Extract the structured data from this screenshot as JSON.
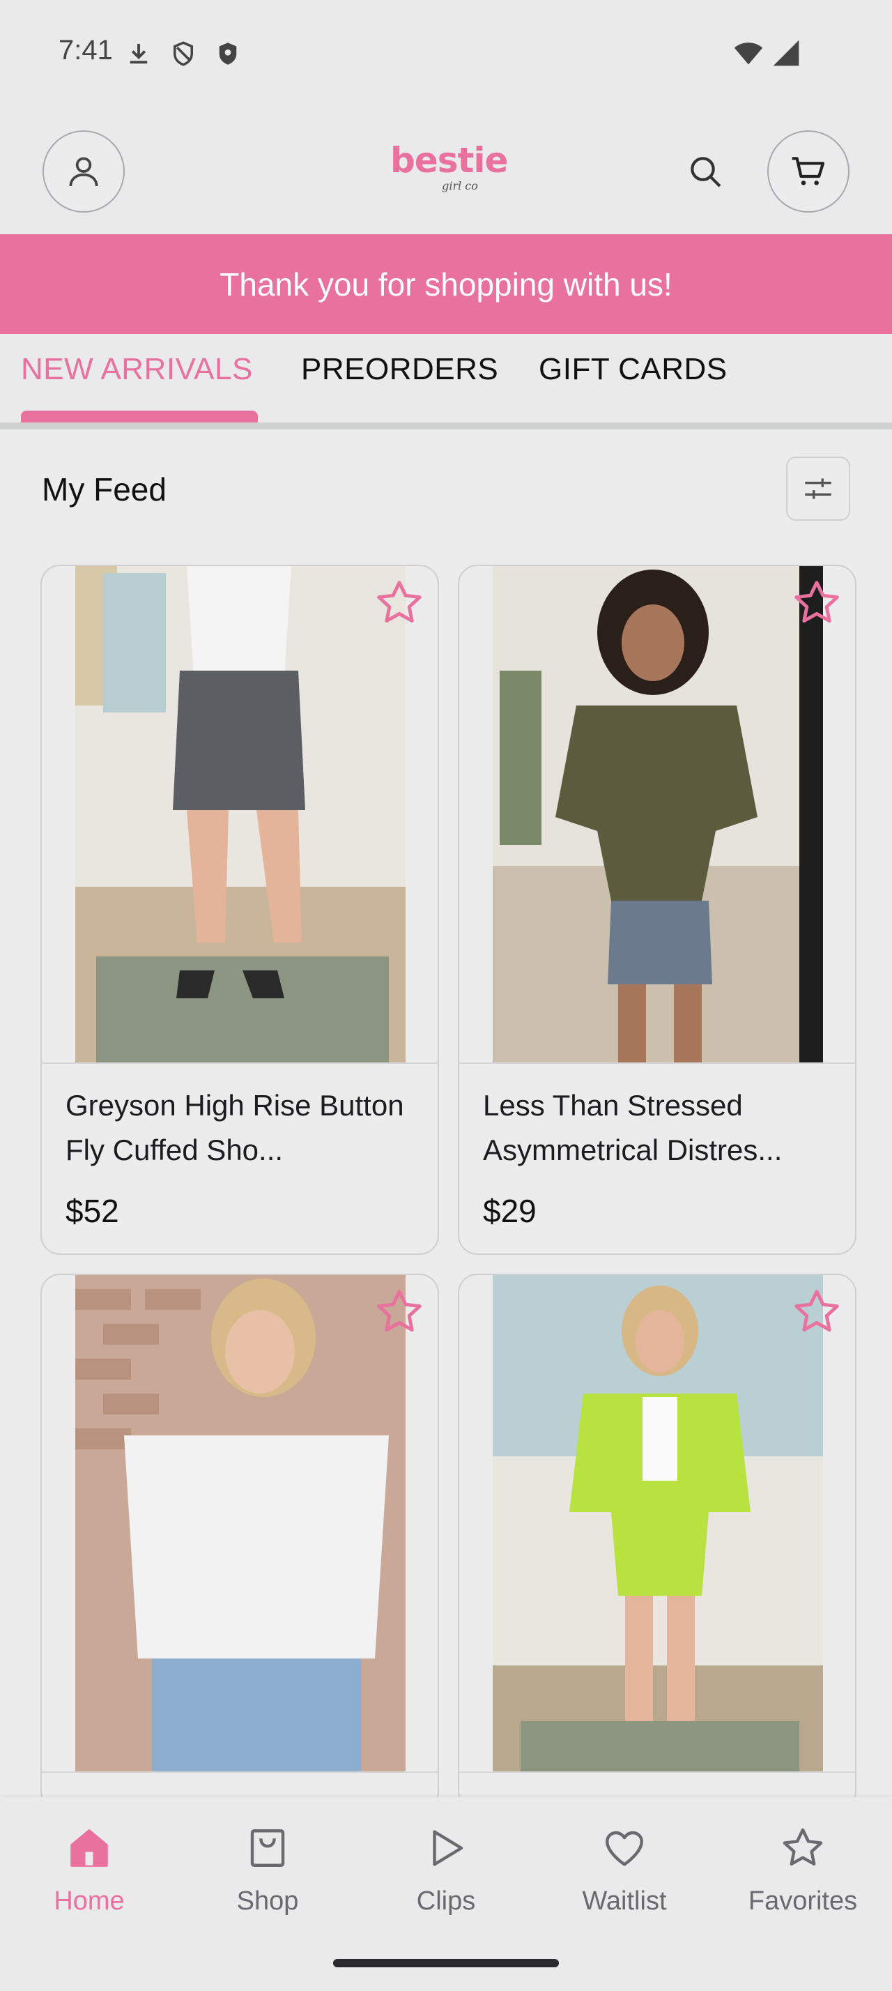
{
  "status_bar": {
    "time": "7:41",
    "icons": [
      "download-icon",
      "shield-outline-icon",
      "shield-filled-icon",
      "wifi-icon",
      "signal-icon"
    ]
  },
  "header": {
    "logo_main": "bestie",
    "logo_sub": "girl co",
    "icons": [
      "profile-icon",
      "search-icon",
      "cart-icon"
    ]
  },
  "banner": {
    "text": "Thank you for shopping with us!"
  },
  "tabs": [
    {
      "label": "NEW ARRIVALS",
      "active": true
    },
    {
      "label": "PREORDERS",
      "active": false
    },
    {
      "label": "GIFT CARDS",
      "active": false
    }
  ],
  "feed": {
    "title": "My Feed",
    "filter_icon": "sliders-icon"
  },
  "products": [
    {
      "name": "Greyson High Rise Button Fly Cuffed Sho...",
      "price": "$52"
    },
    {
      "name": "Less Than Stressed Asymmetrical Distres...",
      "price": "$29"
    },
    {
      "name": "",
      "price": ""
    },
    {
      "name": "",
      "price": ""
    }
  ],
  "bottom_nav": [
    {
      "label": "Home",
      "icon": "home-icon",
      "active": true
    },
    {
      "label": "Shop",
      "icon": "bag-icon",
      "active": false
    },
    {
      "label": "Clips",
      "icon": "play-icon",
      "active": false
    },
    {
      "label": "Waitlist",
      "icon": "heart-icon",
      "active": false
    },
    {
      "label": "Favorites",
      "icon": "star-icon",
      "active": false
    }
  ],
  "colors": {
    "accent": "#e9719d",
    "background": "#ececed",
    "text": "#1c1c1e",
    "muted": "#6a6a6e"
  }
}
